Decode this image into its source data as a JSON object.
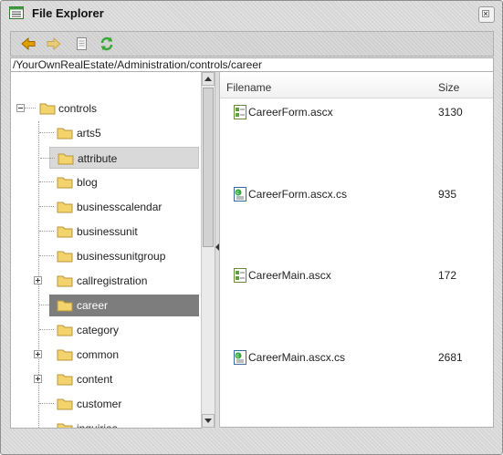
{
  "window": {
    "title": "File Explorer",
    "close_icon": "close-icon"
  },
  "toolbar": {
    "buttons": [
      {
        "name": "back-button",
        "icon": "arrow-left-icon",
        "color": "#e0a000"
      },
      {
        "name": "forward-button",
        "icon": "arrow-right-icon",
        "color": "#e9cc7a"
      },
      {
        "name": "new-document-button",
        "icon": "document-icon"
      },
      {
        "name": "refresh-button",
        "icon": "refresh-icon",
        "color": "#3aa63a"
      }
    ]
  },
  "path": "/YourOwnRealEstate/Administration/controls/career",
  "tree": {
    "root": {
      "label": "controls",
      "expanded": true
    },
    "items": [
      {
        "label": "arts5",
        "expander": false,
        "state": "normal"
      },
      {
        "label": "attribute",
        "expander": false,
        "state": "hover"
      },
      {
        "label": "blog",
        "expander": false,
        "state": "normal"
      },
      {
        "label": "businesscalendar",
        "expander": false,
        "state": "normal"
      },
      {
        "label": "businessunit",
        "expander": false,
        "state": "normal"
      },
      {
        "label": "businessunitgroup",
        "expander": false,
        "state": "normal"
      },
      {
        "label": "callregistration",
        "expander": true,
        "state": "normal"
      },
      {
        "label": "career",
        "expander": false,
        "state": "selected"
      },
      {
        "label": "category",
        "expander": false,
        "state": "normal"
      },
      {
        "label": "common",
        "expander": true,
        "state": "normal"
      },
      {
        "label": "content",
        "expander": true,
        "state": "normal"
      },
      {
        "label": "customer",
        "expander": false,
        "state": "normal"
      },
      {
        "label": "inquiries",
        "expander": false,
        "state": "normal"
      }
    ]
  },
  "files": {
    "columns": {
      "name": "Filename",
      "size": "Size"
    },
    "rows": [
      {
        "name": "CareerForm.ascx",
        "size": "3130",
        "icon": "ascx-file-icon"
      },
      {
        "name": "CareerForm.ascx.cs",
        "size": "935",
        "icon": "cs-file-icon"
      },
      {
        "name": "CareerMain.ascx",
        "size": "172",
        "icon": "ascx-file-icon"
      },
      {
        "name": "CareerMain.ascx.cs",
        "size": "2681",
        "icon": "cs-file-icon"
      }
    ]
  },
  "colors": {
    "selected_bg": "#7d7d7d",
    "hover_bg": "#d9d9d9",
    "folder": "#f3d36b"
  }
}
